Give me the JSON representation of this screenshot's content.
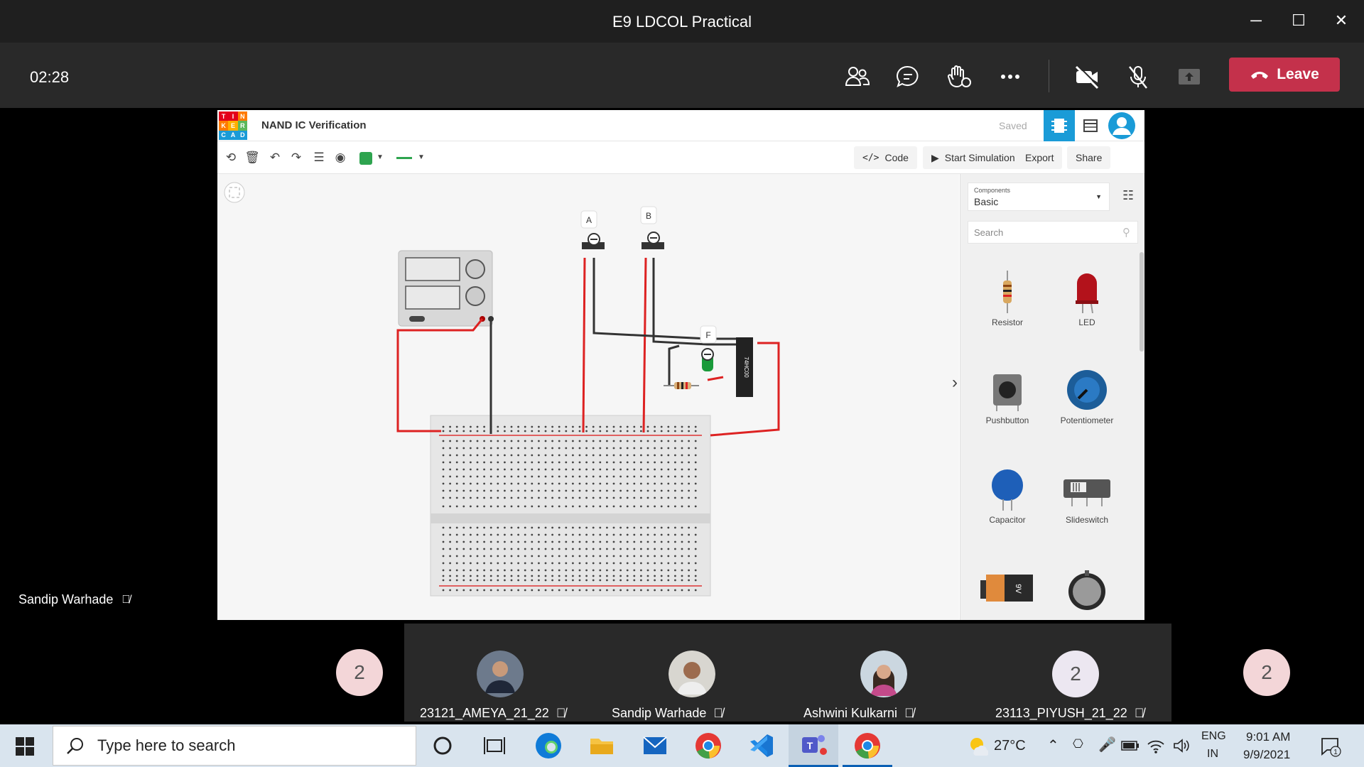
{
  "window": {
    "title": "E9 LDCOL Practical",
    "minimize": "─",
    "maximize": "☐",
    "close": "✕"
  },
  "meeting": {
    "timer": "02:28",
    "leave_label": "Leave",
    "presenter": "Sandip Warhade"
  },
  "tinkercad": {
    "logo": [
      "T",
      "I",
      "N",
      "K",
      "E",
      "R",
      "C",
      "A",
      "D"
    ],
    "logo_colors": [
      "#e3001b",
      "#e3001b",
      "#ff7a00",
      "#ff7a00",
      "#ffb000",
      "#5cb85c",
      "#1a9bd7",
      "#1a9bd7",
      "#1a9bd7"
    ],
    "title": "NAND IC Verification",
    "saved": "Saved",
    "buttons": {
      "code": "Code",
      "start_sim": "Start Simulation",
      "export": "Export",
      "share": "Share"
    },
    "components_label": "Components",
    "components_value": "Basic",
    "search_placeholder": "Search",
    "components": [
      {
        "name": "Resistor"
      },
      {
        "name": "LED"
      },
      {
        "name": "Pushbutton"
      },
      {
        "name": "Potentiometer"
      },
      {
        "name": "Capacitor"
      },
      {
        "name": "Slideswitch"
      }
    ],
    "switch_labels": {
      "a": "A",
      "b": "B",
      "f": "F"
    },
    "ic_label": "74HC00",
    "battery_label": "9V",
    "accent": "#1a9bd7"
  },
  "participants": [
    {
      "name": "",
      "initial": "2",
      "kind": "count"
    },
    {
      "name": "23121_AMEYA_21_22",
      "kind": "photo"
    },
    {
      "name": "Sandip Warhade",
      "kind": "photo"
    },
    {
      "name": "Ashwini Kulkarni",
      "kind": "photo"
    },
    {
      "name": "23113_PIYUSH_21_22",
      "initial": "2",
      "kind": "initial"
    },
    {
      "name": "",
      "initial": "2",
      "kind": "count"
    }
  ],
  "taskbar": {
    "search_placeholder": "Type here to search",
    "weather": "27°C",
    "lang": "ENG",
    "region": "IN",
    "time": "9:01 AM",
    "date": "9/9/2021",
    "notif_count": "1"
  }
}
